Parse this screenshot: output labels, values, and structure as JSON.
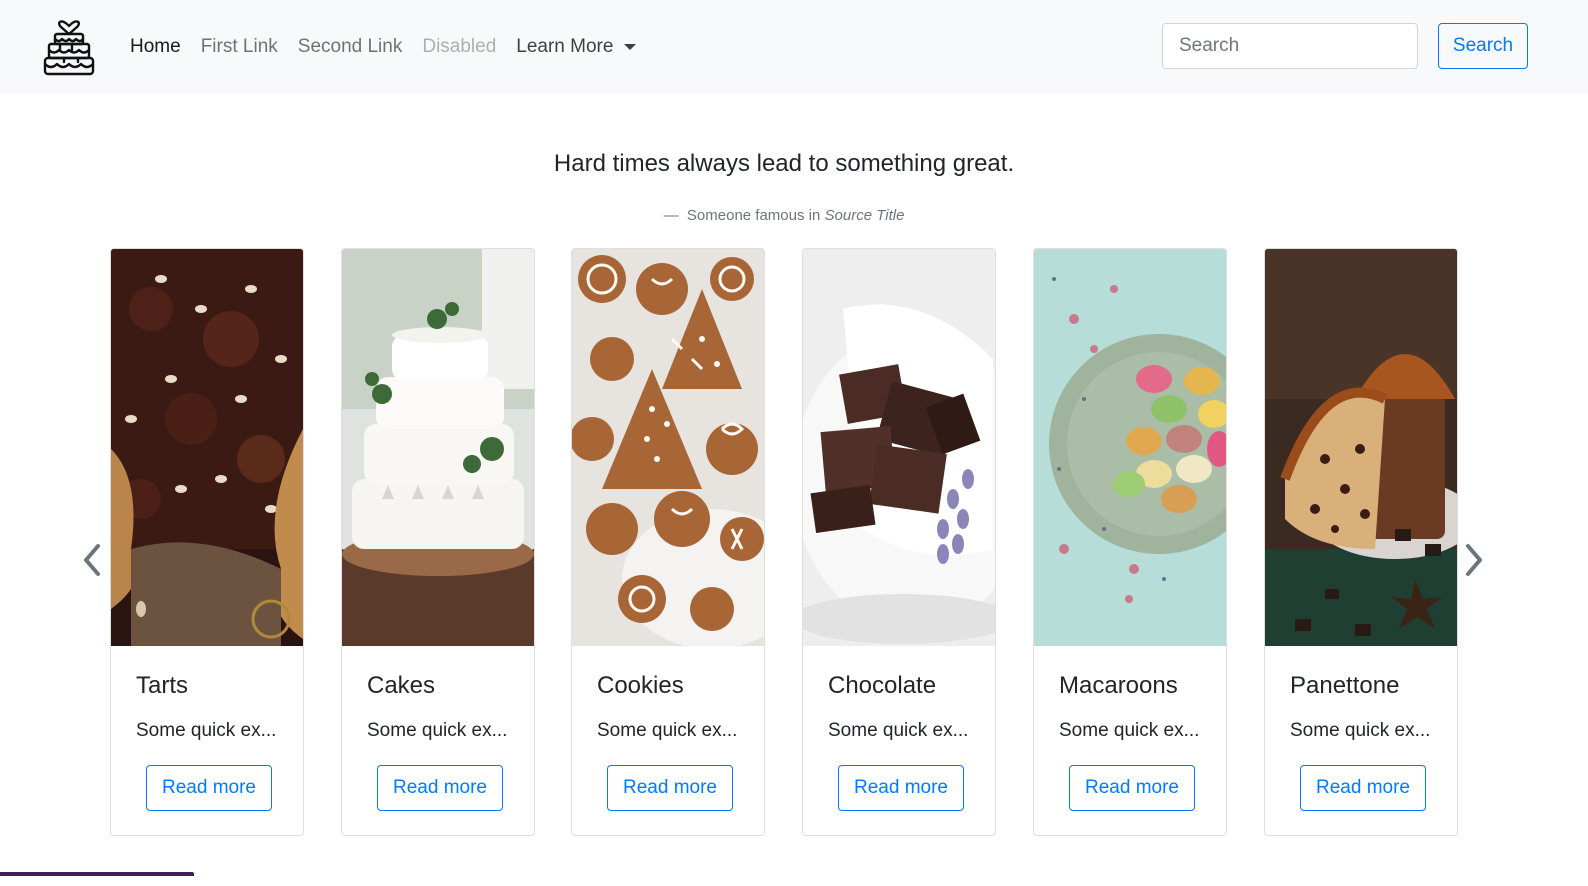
{
  "navbar": {
    "brand_icon": "cake-icon",
    "links": [
      {
        "label": "Home",
        "state": "active"
      },
      {
        "label": "First Link",
        "state": "normal"
      },
      {
        "label": "Second Link",
        "state": "normal"
      },
      {
        "label": "Disabled",
        "state": "disabled"
      }
    ],
    "dropdown_label": "Learn More",
    "search_placeholder": "Search",
    "search_button": "Search"
  },
  "quote": {
    "text": "Hard times always lead to something great.",
    "author": "Someone famous in",
    "source": "Source Title",
    "dash": "—"
  },
  "carousel": {
    "prev_icon": "chevron-left-icon",
    "next_icon": "chevron-right-icon",
    "cards": [
      {
        "title": "Tarts",
        "text": "Some quick ex...",
        "button": "Read more",
        "image": "tart-photo"
      },
      {
        "title": "Cakes",
        "text": "Some quick ex...",
        "button": "Read more",
        "image": "cake-photo"
      },
      {
        "title": "Cookies",
        "text": "Some quick ex...",
        "button": "Read more",
        "image": "cookies-photo"
      },
      {
        "title": "Chocolate",
        "text": "Some quick ex...",
        "button": "Read more",
        "image": "chocolate-photo"
      },
      {
        "title": "Macaroons",
        "text": "Some quick ex...",
        "button": "Read more",
        "image": "macaroons-photo"
      },
      {
        "title": "Panettone",
        "text": "Some quick ex...",
        "button": "Read more",
        "image": "panettone-photo"
      }
    ]
  },
  "colors": {
    "primary": "#007bff",
    "navbar_bg": "#f8f9fa",
    "text": "#212529",
    "muted": "#6c757d"
  }
}
